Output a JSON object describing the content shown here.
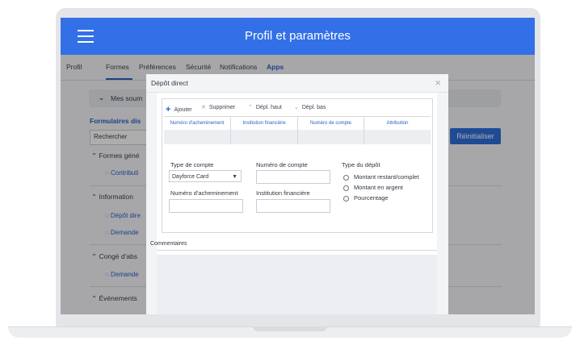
{
  "header": {
    "title": "Profil et paramètres"
  },
  "tabs": [
    {
      "label": "Profil"
    },
    {
      "label": "Formes"
    },
    {
      "label": "Préférences"
    },
    {
      "label": "Sécurité"
    },
    {
      "label": "Notifications"
    },
    {
      "label": "Apps"
    }
  ],
  "background": {
    "mes_section": "Mes soum",
    "formulaires": "Formulaires dis",
    "search_value": "Rechercher",
    "reset_button": "Réinitialiser",
    "formes_section": "Formes géné",
    "contribution": "Contributi",
    "information_section": "Information",
    "depot_link": "Dépôt dire",
    "demande_link_1": "Demande",
    "conge_section": "Congé d'abs",
    "demande_link_2": "Demande",
    "evenements_section": "Événements"
  },
  "dialog": {
    "title": "Dépôt direct",
    "close": "×",
    "toolbar": {
      "add": "Ajouter",
      "delete": "Supprimer",
      "move_up": "Dépl. haut",
      "move_down": "Dépl. bas"
    },
    "grid_headers": [
      "Numéro d'acheminement",
      "Institution financière",
      "Numéro de compte",
      "Attribution"
    ],
    "form": {
      "account_type_label": "Type de compte",
      "account_type_value": "Dayforce Card",
      "account_number_label": "Numéro de compte",
      "routing_number_label": "Numéro d'acheminement",
      "institution_label": "Institution financière",
      "deposit_type_label": "Type du dépôt",
      "deposit_options": [
        "Montant restant/complet",
        "Montant en argent",
        "Pourcentage"
      ]
    },
    "comments_label": "Commentaires"
  },
  "colors": {
    "brand_blue": "#3370e8",
    "link_blue": "#2b61c8"
  }
}
